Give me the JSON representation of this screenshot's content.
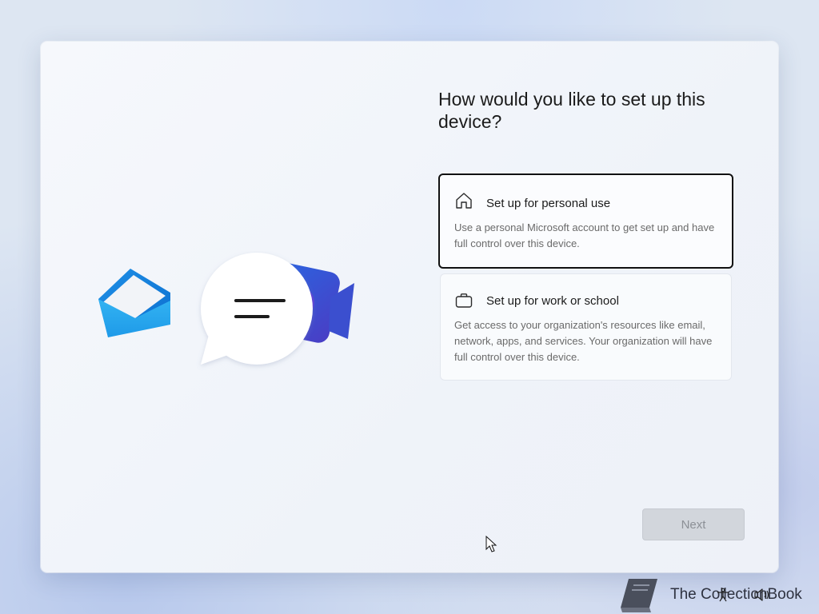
{
  "page": {
    "title": "How would you like to set up this device?"
  },
  "options": [
    {
      "icon": "home-icon",
      "title": "Set up for personal use",
      "description": "Use a personal Microsoft account to get set up and have full control over this device.",
      "selected": true
    },
    {
      "icon": "briefcase-icon",
      "title": "Set up for work or school",
      "description": "Get access to your organization's resources like email, network, apps, and services. Your organization will have full control over this device.",
      "selected": false
    }
  ],
  "buttons": {
    "next_label": "Next",
    "next_enabled": false
  },
  "illustration": {
    "icons": [
      "mail-icon",
      "chat-bubble-icon",
      "video-camera-icon"
    ]
  },
  "watermark": {
    "text": "The CollectionBook"
  },
  "tray": {
    "icons": [
      "accessibility-icon",
      "volume-icon"
    ]
  },
  "colors": {
    "selected_border": "#111111",
    "disabled_button": "#d2d6dc",
    "title_text": "#1b1b1b",
    "description_text": "#6a6a6a"
  }
}
